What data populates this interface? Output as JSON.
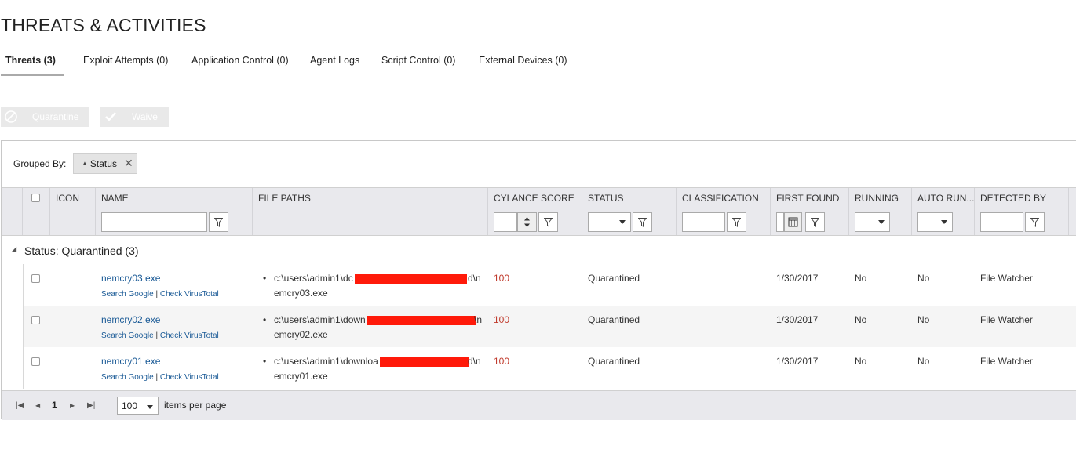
{
  "page": {
    "title": "THREATS & ACTIVITIES"
  },
  "tabs": [
    {
      "label": "Threats (3)",
      "active": true
    },
    {
      "label": "Exploit Attempts (0)"
    },
    {
      "label": "Application Control (0)"
    },
    {
      "label": "Agent Logs"
    },
    {
      "label": "Script Control (0)"
    },
    {
      "label": "External Devices (0)"
    }
  ],
  "actions": {
    "quarantine_label": "Quarantine",
    "waive_label": "Waive"
  },
  "grouping": {
    "label": "Grouped By:",
    "chip": "Status",
    "chip_icon": "sort-asc-icon",
    "remove_icon": "close-icon"
  },
  "columns": [
    "ICON",
    "NAME",
    "FILE PATHS",
    "CYLANCE SCORE",
    "STATUS",
    "CLASSIFICATION",
    "FIRST FOUND",
    "RUNNING",
    "AUTO RUN...",
    "DETECTED BY"
  ],
  "group": {
    "label": "Status: Quarantined (3)"
  },
  "rows": [
    {
      "name": "nemcry03.exe",
      "search_google": "Search Google",
      "sep": "|",
      "check_vt": "Check VirusTotal",
      "path_line1": "c:\\users\\admin1\\dc",
      "path_end1": "d\\n",
      "path_line2": "emcry03.exe",
      "score": "100",
      "status": "Quarantined",
      "classification": "",
      "first_found": "1/30/2017",
      "running": "No",
      "auto_run": "No",
      "detected_by": "File Watcher"
    },
    {
      "name": "nemcry02.exe",
      "search_google": "Search Google",
      "sep": "|",
      "check_vt": "Check VirusTotal",
      "path_line1": "c:\\users\\admin1\\down",
      "path_end1": "\\n",
      "path_line2": "emcry02.exe",
      "score": "100",
      "status": "Quarantined",
      "classification": "",
      "first_found": "1/30/2017",
      "running": "No",
      "auto_run": "No",
      "detected_by": "File Watcher"
    },
    {
      "name": "nemcry01.exe",
      "search_google": "Search Google",
      "sep": "|",
      "check_vt": "Check VirusTotal",
      "path_line1": "c:\\users\\admin1\\downloa",
      "path_end1": "d\\n",
      "path_line2": "emcry01.exe",
      "score": "100",
      "status": "Quarantined",
      "classification": "",
      "first_found": "1/30/2017",
      "running": "No",
      "auto_run": "No",
      "detected_by": "File Watcher"
    }
  ],
  "pager": {
    "current_page": "1",
    "page_size": "100",
    "items_per_page_label": "items per page"
  },
  "colors": {
    "link": "#1a5a96",
    "score": "#c0392b",
    "header_bg": "#e9e9ed",
    "redaction": "#ff1a0a"
  }
}
